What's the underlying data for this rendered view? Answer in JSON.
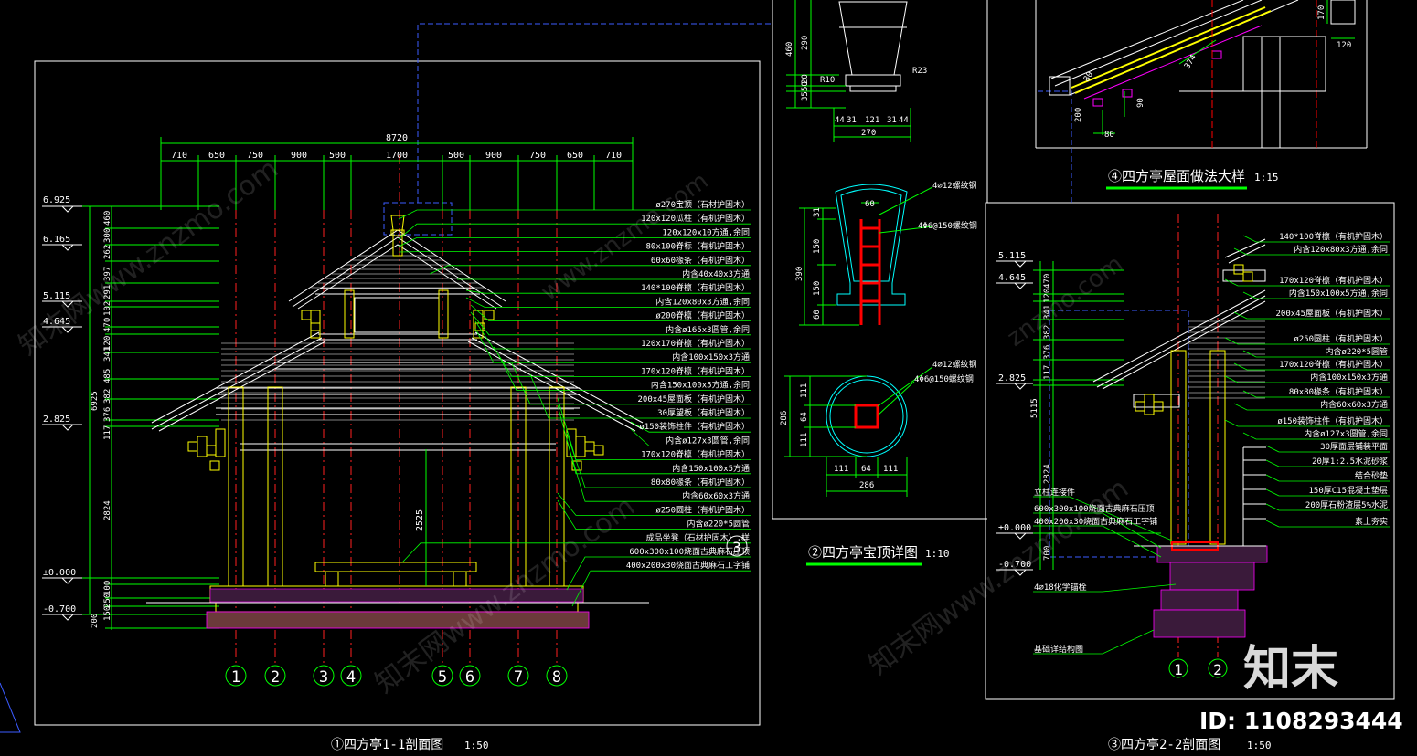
{
  "colors": {
    "bg": "#000000",
    "frame": "#ffffff",
    "dim": "#00ff00",
    "roof": "#ffffff",
    "post": "#ffff00",
    "axis": "#ff0000",
    "detail": "#00ffff",
    "leader": "#00ff00"
  },
  "section11": {
    "title": "①四方亭1-1剖面图",
    "scale": "1:50",
    "overall_dim": "8720",
    "top_dims": [
      "710",
      "650",
      "750",
      "900",
      "500",
      "1700",
      "500",
      "900",
      "750",
      "650",
      "710"
    ],
    "levels": [
      "6.925",
      "6.165",
      "5.115",
      "4.645",
      "2.825",
      "±0.000",
      "-0.700"
    ],
    "left_dims": [
      "460",
      "300",
      "262",
      "397",
      "291",
      "102",
      "470",
      "120",
      "341",
      "485",
      "382",
      "376",
      "117",
      "6925",
      "2824",
      "100",
      "250",
      "150",
      "200"
    ],
    "mid_dim": "2525",
    "axes": [
      "1",
      "2",
      "3",
      "4",
      "5",
      "6",
      "7",
      "8"
    ],
    "axis3_tag": "3",
    "notes": [
      "ø270宝顶（石材护固木）",
      "120x120瓜柱（有机护固木）",
      "120x120x10方通,余同",
      "80x100脊标（有机护固木）",
      "60x60椽条（有机护固木）",
      "内含40x40x3方通",
      "140*100脊檩（有机护固木）",
      "内含120x80x3方通,余同",
      "ø200脊檩（有机护固木）",
      "内含ø165x3圆管,余同",
      "120x170脊檩（有机护固木）",
      "内含100x150x3方通",
      "170x120脊檩（有机护固木）",
      "内含150x100x5方通,余同",
      "200x45屋面板（有机护固木）",
      "30厚望板（有机护固木）",
      "ø150装饰柱件（有机护固木）",
      "内含ø127x3圆管,余同",
      "170x120脊檩（有机护固木）",
      "内含150x100x5方通",
      "80x80椽条（有机护固木）",
      "内含60x60x3方通",
      "ø250圆柱（有机护固木）",
      "内含ø220*5圆管",
      "成品坐凳（石材护固木）,样",
      "600x300x100烧面古典麻石压顶",
      "400x200x30烧面古典麻石工字铺"
    ]
  },
  "finial": {
    "title": "②四方亭宝顶详图",
    "scale": "1:10",
    "dims_v": [
      "460",
      "290",
      "50",
      "35",
      "20"
    ],
    "r_labels": [
      "R10",
      "R23"
    ],
    "dims_h": [
      "44",
      "31",
      "121",
      "31",
      "44"
    ],
    "total_w": "270",
    "bar_note_top": "4⌀12螺纹钢",
    "bar_note_2": "4Φ6@150螺纹钢",
    "sect_v": [
      "31",
      "150",
      "390",
      "150",
      "60"
    ],
    "sect_w": "60",
    "plan_v": [
      "111",
      "64",
      "111",
      "286"
    ],
    "plan_h": [
      "111",
      "64",
      "111"
    ],
    "plan_w": "286"
  },
  "roof_detail": {
    "title": "④四方亭屋面做法大样",
    "scale": "1:15",
    "dims": [
      "170",
      "120",
      "374",
      "80",
      "90",
      "200",
      "80"
    ]
  },
  "section22": {
    "title": "③四方亭2-2剖面图",
    "scale": "1:50",
    "levels": [
      "5.115",
      "4.645",
      "2.825",
      "±0.000",
      "-0.700"
    ],
    "left_dims": [
      "470",
      "120",
      "341",
      "382",
      "376",
      "117",
      "5115",
      "2824",
      "700"
    ],
    "axes": [
      "1",
      "2"
    ],
    "left_notes": [
      "立柱连接件",
      "600x300x100烧面古典麻石压顶",
      "400x200x30烧面古典麻石工字铺",
      "4⌀18化学锚栓",
      "基础详结构图"
    ],
    "notes": [
      "140*100脊檩（有机护固木）",
      "内含120x80x3方通,余同",
      "170x120脊檩（有机护固木）",
      "内含150x100x5方通,余同",
      "200x45屋面板（有机护固木）",
      "ø250圆柱（有机护固木）",
      "内含ø220*5圆管",
      "170x120脊檩（有机护固木）",
      "内含100x150x3方通",
      "80x80椽条（有机护固木）",
      "内含60x60x3方通",
      "ø150装饰柱件（有机护固木）",
      "内含ø127x3圆管,余同",
      "30厚面层铺装平面",
      "20厚1:2.5水泥砂浆",
      "结合砂垫",
      "150厚C15混凝土垫层",
      "200厚石粉渣层5%水泥",
      "素土夯实"
    ]
  },
  "watermarks": [
    "知末网www.znzmo.com",
    "www.znzmo.com",
    "知末网www.znzmo.com",
    "知末网www.znzmo.com",
    "znzmo.com"
  ],
  "logo": "知末",
  "id_label": "ID: 1108293444"
}
